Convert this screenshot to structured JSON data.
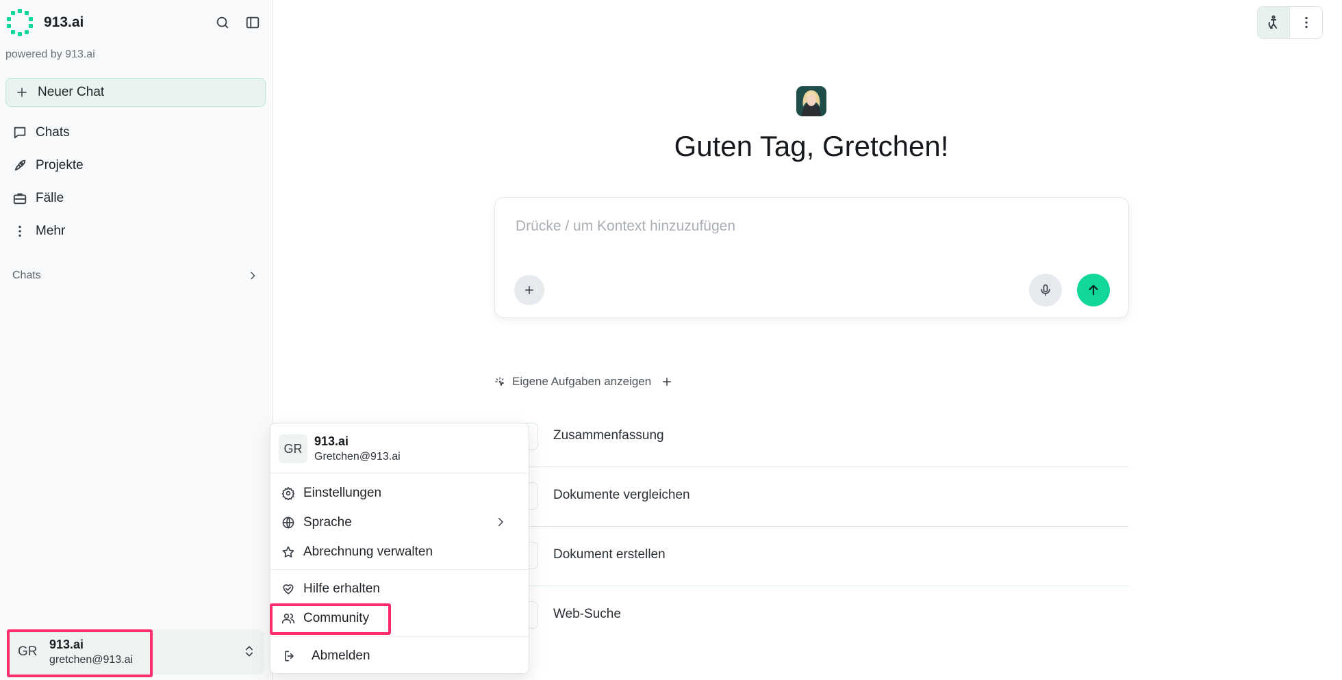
{
  "brand": {
    "name": "913.ai",
    "powered_by": "powered by 913.ai",
    "accent": "#12d79a"
  },
  "sidebar": {
    "new_chat_label": "Neuer Chat",
    "items": [
      {
        "label": "Chats",
        "icon": "message-icon"
      },
      {
        "label": "Projekte",
        "icon": "rocket-icon"
      },
      {
        "label": "Fälle",
        "icon": "briefcase-icon"
      },
      {
        "label": "Mehr",
        "icon": "more-vertical-icon"
      }
    ],
    "section_label": "Chats",
    "account": {
      "initials": "GR",
      "org": "913.ai",
      "email": "gretchen@913.ai"
    }
  },
  "main": {
    "greeting": "Guten Tag, Gretchen!",
    "composer_placeholder": "Drücke / um Kontext hinzuzufügen",
    "tasks_label": "Eigene Aufgaben anzeigen",
    "suggestions": [
      "Zusammenfassung",
      "Dokumente vergleichen",
      "Dokument erstellen",
      "Web-Suche"
    ]
  },
  "menu": {
    "initials": "GR",
    "org": "913.ai",
    "email": "Gretchen@913.ai",
    "items": {
      "settings": "Einstellungen",
      "language": "Sprache",
      "billing": "Abrechnung verwalten",
      "help": "Hilfe erhalten",
      "community": "Community",
      "logout": "Abmelden"
    }
  },
  "colors": {
    "highlight": "#ff2d6e",
    "send": "#12d79a"
  }
}
